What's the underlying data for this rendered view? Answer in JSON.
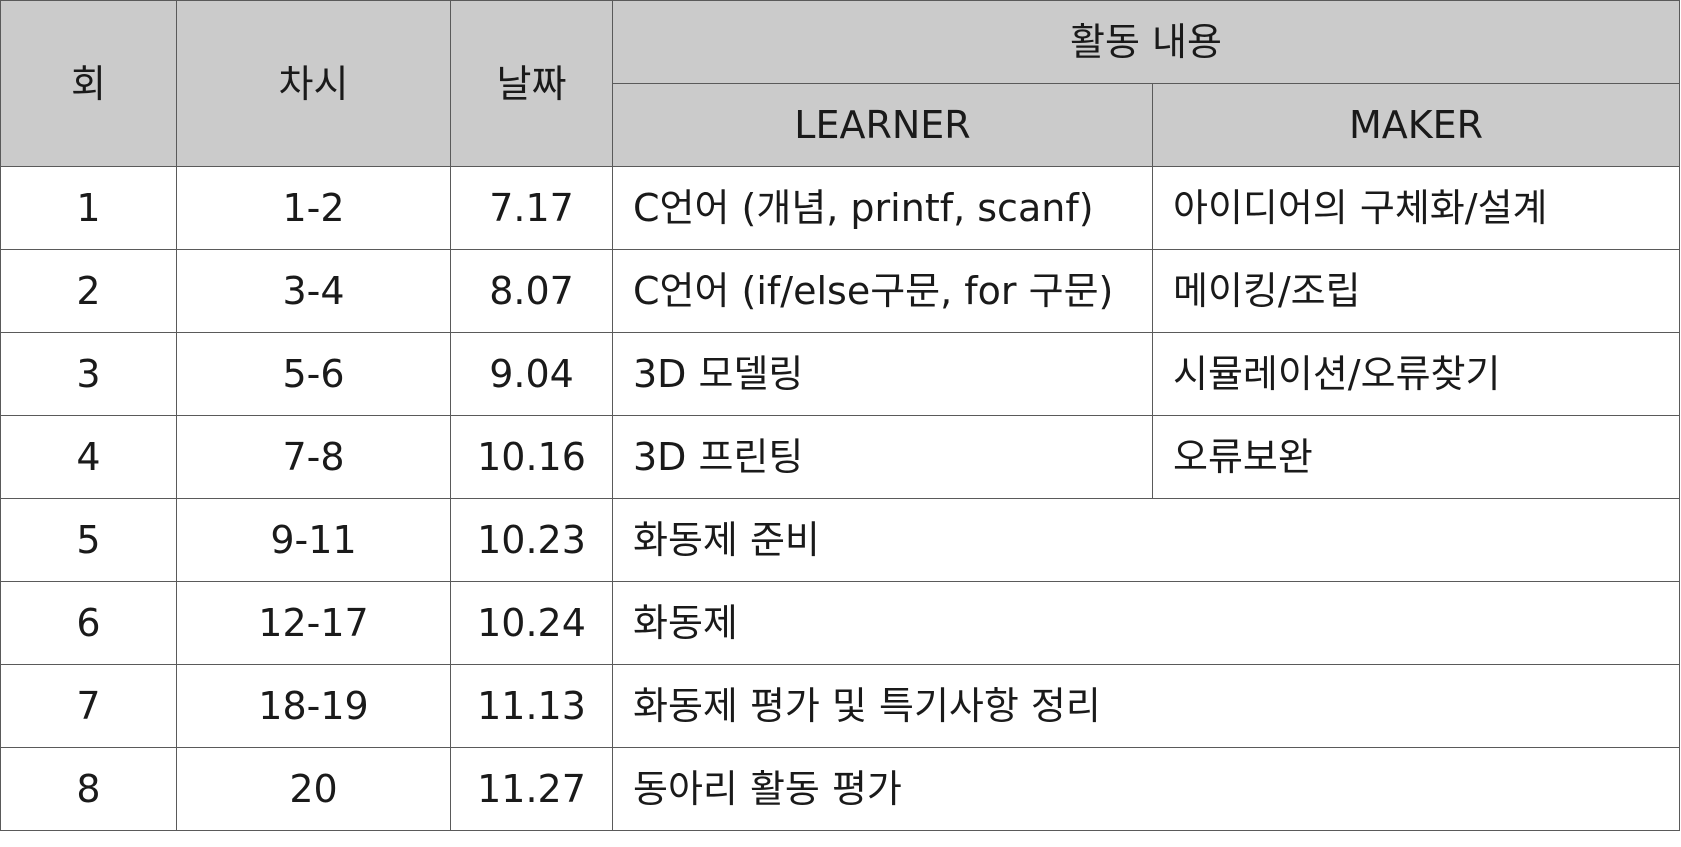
{
  "table": {
    "headers": {
      "no": "회",
      "session": "차시",
      "date": "날짜",
      "activity": "활동 내용",
      "learner": "LEARNER",
      "maker": "MAKER"
    },
    "rows": [
      {
        "no": "1",
        "session": "1-2",
        "date": "7.17",
        "learner": "C언어 (개념, printf, scanf)",
        "maker": "아이디어의 구체화/설계"
      },
      {
        "no": "2",
        "session": "3-4",
        "date": "8.07",
        "learner": "C언어 (if/else구문, for 구문)",
        "maker": "메이킹/조립"
      },
      {
        "no": "3",
        "session": "5-6",
        "date": "9.04",
        "learner": "3D 모델링",
        "maker": "시뮬레이션/오류찾기"
      },
      {
        "no": "4",
        "session": "7-8",
        "date": "10.16",
        "learner": "3D 프린팅",
        "maker": "오류보완"
      },
      {
        "no": "5",
        "session": "9-11",
        "date": "10.23",
        "activity": "화동제 준비"
      },
      {
        "no": "6",
        "session": "12-17",
        "date": "10.24",
        "activity": "화동제"
      },
      {
        "no": "7",
        "session": "18-19",
        "date": "11.13",
        "activity": "화동제 평가 및 특기사항 정리"
      },
      {
        "no": "8",
        "session": "20",
        "date": "11.27",
        "activity": "동아리 활동 평가"
      }
    ]
  },
  "colors": {
    "header_bg": "#cbcbcb",
    "border": "#5a5a5a",
    "text": "#1a1a1a"
  }
}
